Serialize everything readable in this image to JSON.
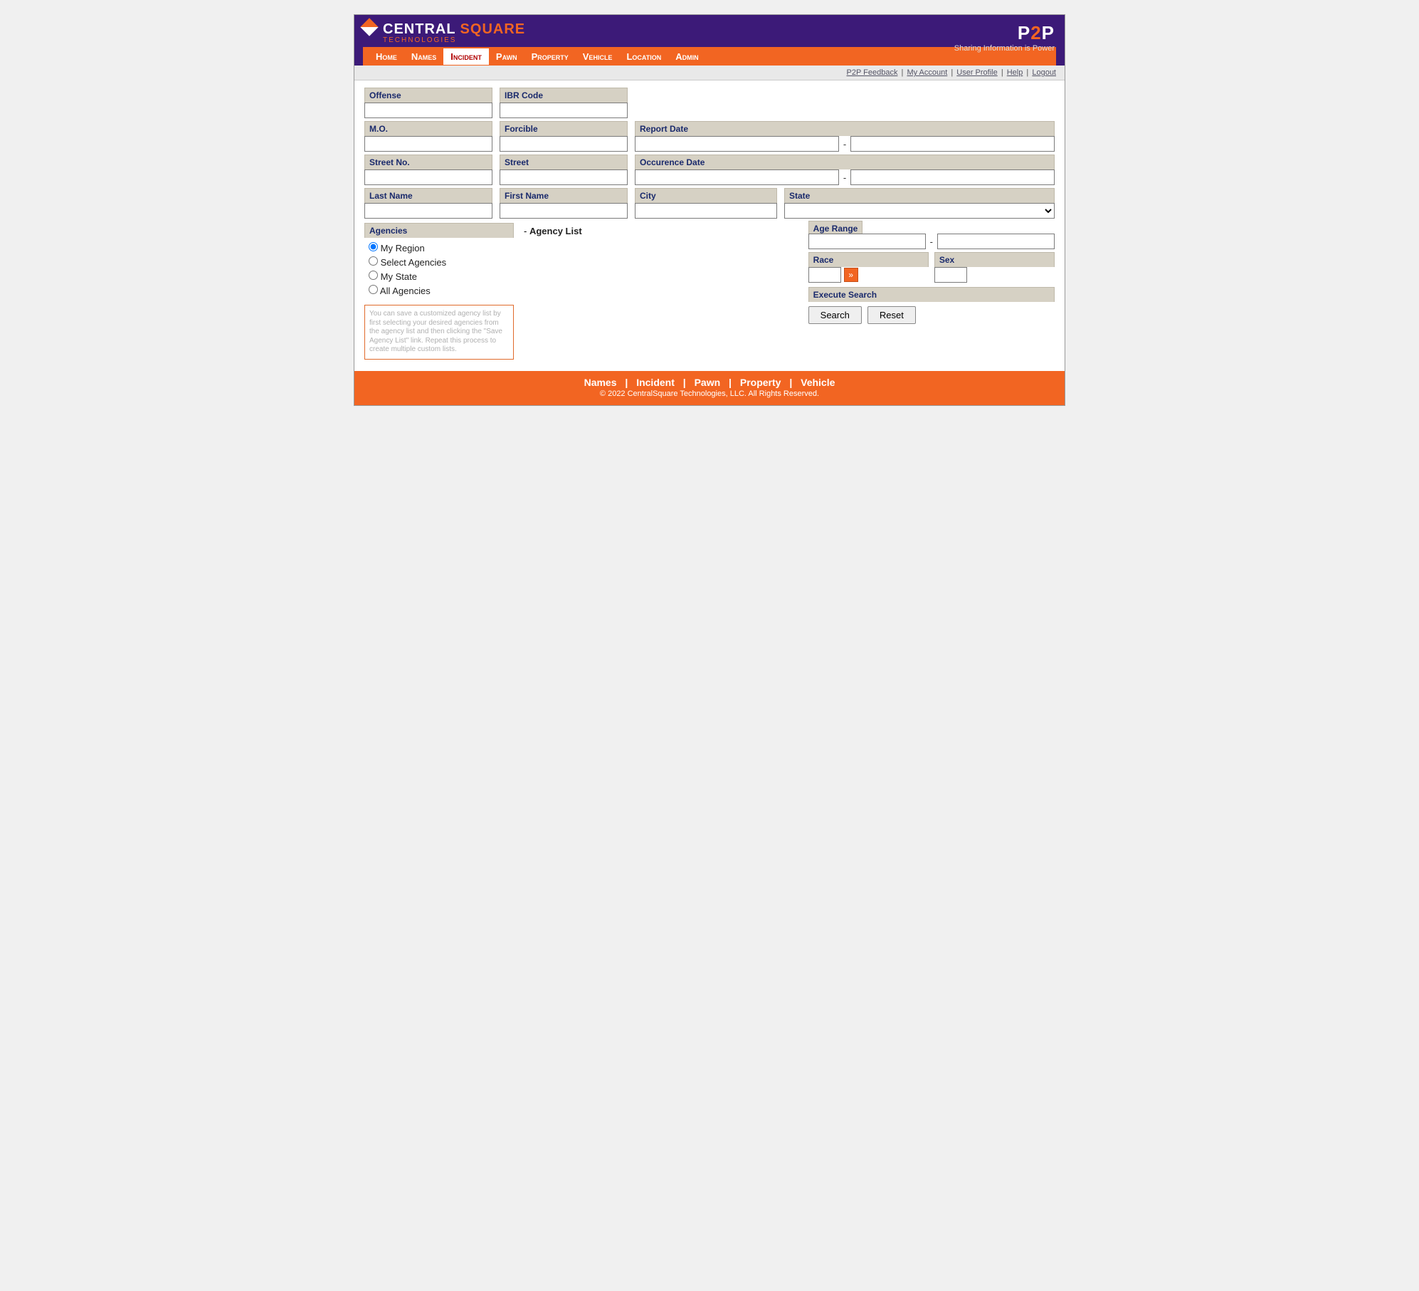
{
  "brand": {
    "name1": "CENTRAL",
    "name2": "SQUARE",
    "sub": "TECHNOLOGIES"
  },
  "p2p": {
    "logo_p1": "P",
    "logo_2": "2",
    "logo_p2": "P",
    "tagline": "Sharing Information is Power"
  },
  "nav": {
    "home": "Home",
    "names": "Names",
    "incident": "Incident",
    "pawn": "Pawn",
    "property": "Property",
    "vehicle": "Vehicle",
    "location": "Location",
    "admin": "Admin"
  },
  "subnav": {
    "feedback": "P2P Feedback",
    "account": "My Account",
    "profile": "User Profile",
    "help": "Help",
    "logout": "Logout",
    "sep": " | "
  },
  "labels": {
    "offense": "Offense",
    "ibr": "IBR Code",
    "mo": "M.O.",
    "forcible": "Forcible",
    "reportdate": "Report Date",
    "streetno": "Street No.",
    "street": "Street",
    "occdate": "Occurence Date",
    "lastname": "Last Name",
    "firstname": "First Name",
    "city": "City",
    "agencies": "Agencies",
    "agerange": "Age Range",
    "state": "State",
    "race": "Race",
    "sex": "Sex",
    "exec": "Execute Search",
    "agencylist": "Agency List",
    "dash": "-"
  },
  "radios": {
    "myregion": "My Region",
    "selectagencies": "Select Agencies",
    "mystate": "My State",
    "allagencies": "All Agencies"
  },
  "tip": "You can save a customized agency list by first selecting your desired agencies from the agency list and then clicking the \"Save Agency List\" link. Repeat this process to create multiple custom lists.",
  "buttons": {
    "search": "Search",
    "reset": "Reset",
    "arrow": "»"
  },
  "footer": {
    "names": "Names",
    "incident": "Incident",
    "pawn": "Pawn",
    "property": "Property",
    "vehicle": "Vehicle",
    "sep": " | ",
    "copy": "© 2022 CentralSquare Technologies, LLC. All Rights Reserved."
  }
}
